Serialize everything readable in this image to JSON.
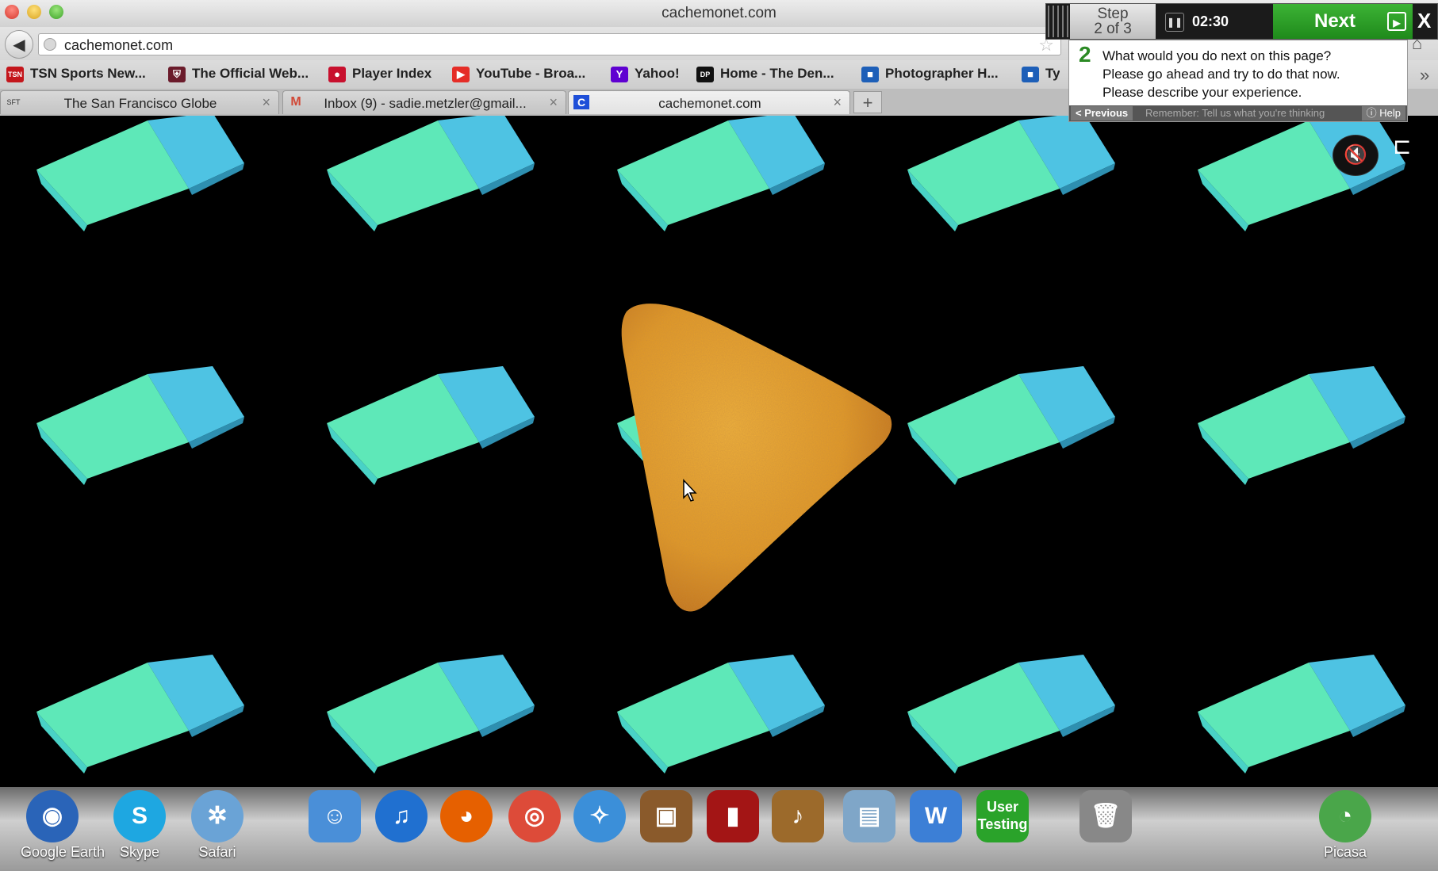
{
  "window": {
    "title": "cachemonet.com"
  },
  "navbar": {
    "url": "cachemonet.com"
  },
  "bookmarks": [
    {
      "label": "TSN Sports New...",
      "icon": "tsn-icon",
      "color": "#c4161c"
    },
    {
      "label": "The Official Web...",
      "icon": "team-logo-icon",
      "color": "#6b1b2b"
    },
    {
      "label": "Player Index",
      "icon": "nhl-logo-icon",
      "color": "#c8102e"
    },
    {
      "label": "YouTube - Broa...",
      "icon": "youtube-icon",
      "color": "#e52d27"
    },
    {
      "label": "Yahoo!",
      "icon": "yahoo-icon",
      "color": "#5f01d1"
    },
    {
      "label": "Home - The Den...",
      "icon": "dp-icon",
      "color": "#111111"
    },
    {
      "label": "Photographer H...",
      "icon": "bookmark-cube-icon",
      "color": "#1d5fb8"
    },
    {
      "label": "Tyl",
      "icon": "bookmark-cube-icon",
      "color": "#1d5fb8"
    }
  ],
  "tabs": [
    {
      "label": "The San Francisco Globe",
      "icon": "sft-icon",
      "icon_text": "SFT",
      "active": false
    },
    {
      "label": "Inbox (9) - sadie.metzler@gmail...",
      "icon": "gmail-icon",
      "icon_text": "M",
      "active": false
    },
    {
      "label": "cachemonet.com",
      "icon": "cachemonet-icon",
      "icon_text": "C",
      "active": true
    }
  ],
  "new_tab_symbol": "+",
  "usertesting": {
    "step_title": "Step",
    "step_count": "2 of 3",
    "timer": "02:30",
    "next_label": "Next",
    "close_label": "X",
    "task_number": "2",
    "question_lines": [
      "What would you do next on this page?",
      "Please go ahead and try to do that now.",
      "Please describe your experience."
    ],
    "previous_label": "< Previous",
    "remember_text": "Remember: Tell us what you're thinking",
    "help_label": "Help",
    "accent_color": "#2b8a24"
  },
  "page": {
    "cube_colors": {
      "front": "#5ee8b8",
      "side": "#4ec3e3",
      "top": "#49d2c6"
    },
    "chip_color": "#e39a24"
  },
  "dock": {
    "items": [
      {
        "label": "Google Earth",
        "icon": "google-earth-icon",
        "color": "#2a64b8"
      },
      {
        "label": "Skype",
        "icon": "skype-icon",
        "color": "#1ea7e1"
      },
      {
        "label": "Safari",
        "icon": "safari-icon",
        "color": "#6aa3d6"
      },
      {
        "label": "",
        "icon": "finder-icon",
        "color": "#4a8fd8"
      },
      {
        "label": "",
        "icon": "itunes-icon",
        "color": "#2070d0"
      },
      {
        "label": "",
        "icon": "firefox-icon",
        "color": "#e66000"
      },
      {
        "label": "",
        "icon": "chrome-icon",
        "color": "#dd4b39"
      },
      {
        "label": "",
        "icon": "safari-compass-icon",
        "color": "#3b8fd9"
      },
      {
        "label": "",
        "icon": "iphoto-icon",
        "color": "#8a5a2b"
      },
      {
        "label": "",
        "icon": "photo-booth-icon",
        "color": "#a31515"
      },
      {
        "label": "",
        "icon": "garageband-icon",
        "color": "#9c6a2b"
      },
      {
        "label": "",
        "icon": "preview-icon",
        "color": "#7fa6c8"
      },
      {
        "label": "",
        "icon": "word-icon",
        "color": "#3c7fd6"
      },
      {
        "label": "",
        "icon": "usertesting-icon",
        "color": "#2aa32a",
        "text": "User Testing"
      },
      {
        "label": "",
        "icon": "trash-icon",
        "color": "#888888"
      },
      {
        "label": "Picasa",
        "icon": "picasa-icon",
        "color": "#4aa64a"
      }
    ]
  }
}
